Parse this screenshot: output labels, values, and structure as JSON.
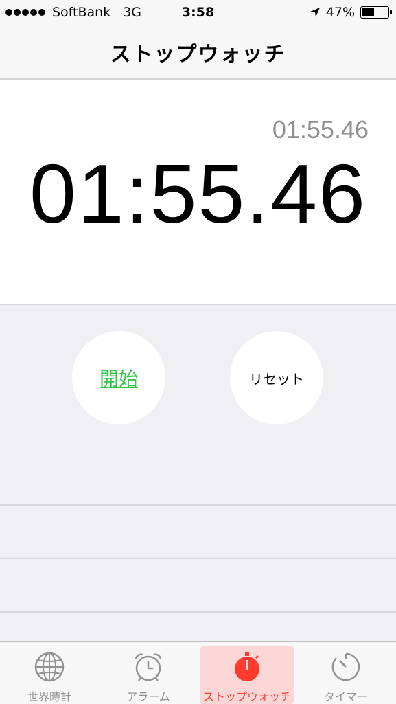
{
  "status_bar": {
    "carrier": "SoftBank",
    "network": "3G",
    "time": "3:58",
    "battery": "47%"
  },
  "nav": {
    "title": "ストップウォッチ"
  },
  "stopwatch": {
    "lap_time": "01:55.46",
    "main_time": "01:55.46",
    "start_label": "開始",
    "reset_label": "リセット"
  },
  "tabs": [
    {
      "label": "世界時計",
      "icon": "globe-icon"
    },
    {
      "label": "アラーム",
      "icon": "alarm-clock-icon"
    },
    {
      "label": "ストップウォッチ",
      "icon": "stopwatch-icon"
    },
    {
      "label": "タイマー",
      "icon": "timer-icon"
    }
  ],
  "colors": {
    "start_green": "#2ec549",
    "active_red": "#ff3b30",
    "inactive_gray": "#929292"
  }
}
